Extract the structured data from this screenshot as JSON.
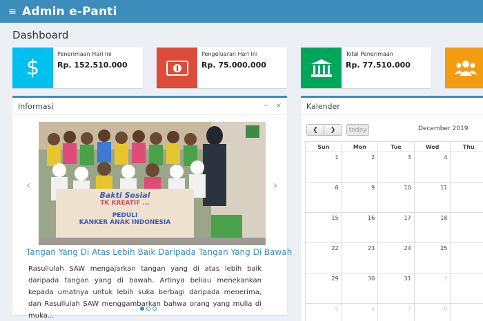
{
  "header": {
    "title": "Admin e-Panti"
  },
  "page": {
    "title": "Dashboard"
  },
  "stats": [
    {
      "label": "Penerimaan Hari Ini",
      "value": "Rp. 152.510.000",
      "icon": "dollar-icon",
      "color": "#00c0ef"
    },
    {
      "label": "Pengeluaran Hari Ini",
      "value": "Rp. 75.000.000",
      "icon": "money-icon",
      "color": "#dd4b39"
    },
    {
      "label": "Total Penerimaan",
      "value": "Rp. 77.510.000",
      "icon": "bank-icon",
      "color": "#00a65a"
    },
    {
      "label": "",
      "value": "",
      "icon": "users-icon",
      "color": "#f39c12"
    }
  ],
  "info": {
    "title": "Informasi",
    "banner": {
      "line1": "Bakti Sosial",
      "line2": "TK KREATIF ...",
      "line3": "PEDULI",
      "line4": "KANKER ANAK INDONESIA"
    },
    "headline": "Tangan Yang Di Atas Lebih Baik Daripada Tangan Yang Di Bawah",
    "excerpt": "Rasullulah SAW mengajarkan tangan yang di atas lebih baik daripada tangan yang di bawah. Artinya beliau menekankan kepada umatnya untuk lebih suka berbagi daripada menerima, dan Rasullulah SAW menggambarkan bahwa orang yang mulia di muka...",
    "slide_count": 3,
    "active_slide": 1
  },
  "calendar": {
    "title": "Kalender",
    "month": "December 2019",
    "today_label": "today",
    "weekdays": [
      "Sun",
      "Mon",
      "Tue",
      "Wed",
      "Thu"
    ],
    "weeks": [
      [
        "1",
        "2",
        "3",
        "4",
        ""
      ],
      [
        "8",
        "9",
        "10",
        "11",
        ""
      ],
      [
        "15",
        "16",
        "17",
        "18",
        ""
      ],
      [
        "22",
        "23",
        "24",
        "25",
        ""
      ],
      [
        "29",
        "30",
        "31",
        "1",
        ""
      ],
      [
        "5",
        "6",
        "7",
        "8",
        ""
      ]
    ]
  },
  "colors": {
    "primary": "#3c8dbc",
    "background": "#ecf0f5"
  }
}
